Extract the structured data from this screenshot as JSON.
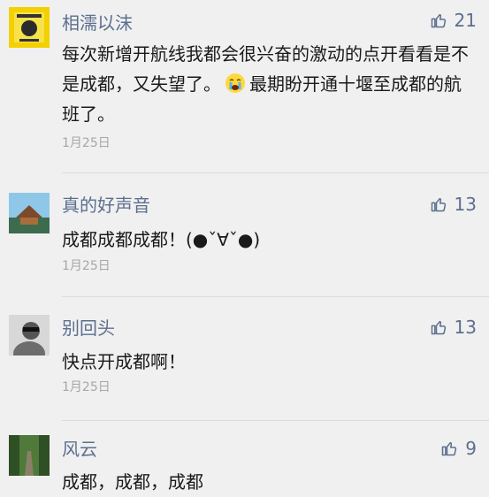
{
  "comments": [
    {
      "name": "相濡以沫",
      "likes": "21",
      "text_part1": "每次新增开航线我都会很兴奋的激动的点开看看是不是成都，又失望了。",
      "emoji_icon": "crying-face-emoji-icon",
      "text_part2": "最期盼开通十堰至成都的航班了。",
      "date": "1月25日"
    },
    {
      "name": "真的好声音",
      "likes": "13",
      "text": "成都成都成都！(●ˇ∀ˇ●)",
      "date": "1月25日"
    },
    {
      "name": "别回头",
      "likes": "13",
      "text": "快点开成都啊！",
      "date": "1月25日"
    },
    {
      "name": "风云",
      "likes": "9",
      "text": "成都，成都，成都"
    }
  ],
  "colors": {
    "name": "#5c6f8f",
    "date": "#a7a7a7",
    "background": "#f0f0f0"
  }
}
